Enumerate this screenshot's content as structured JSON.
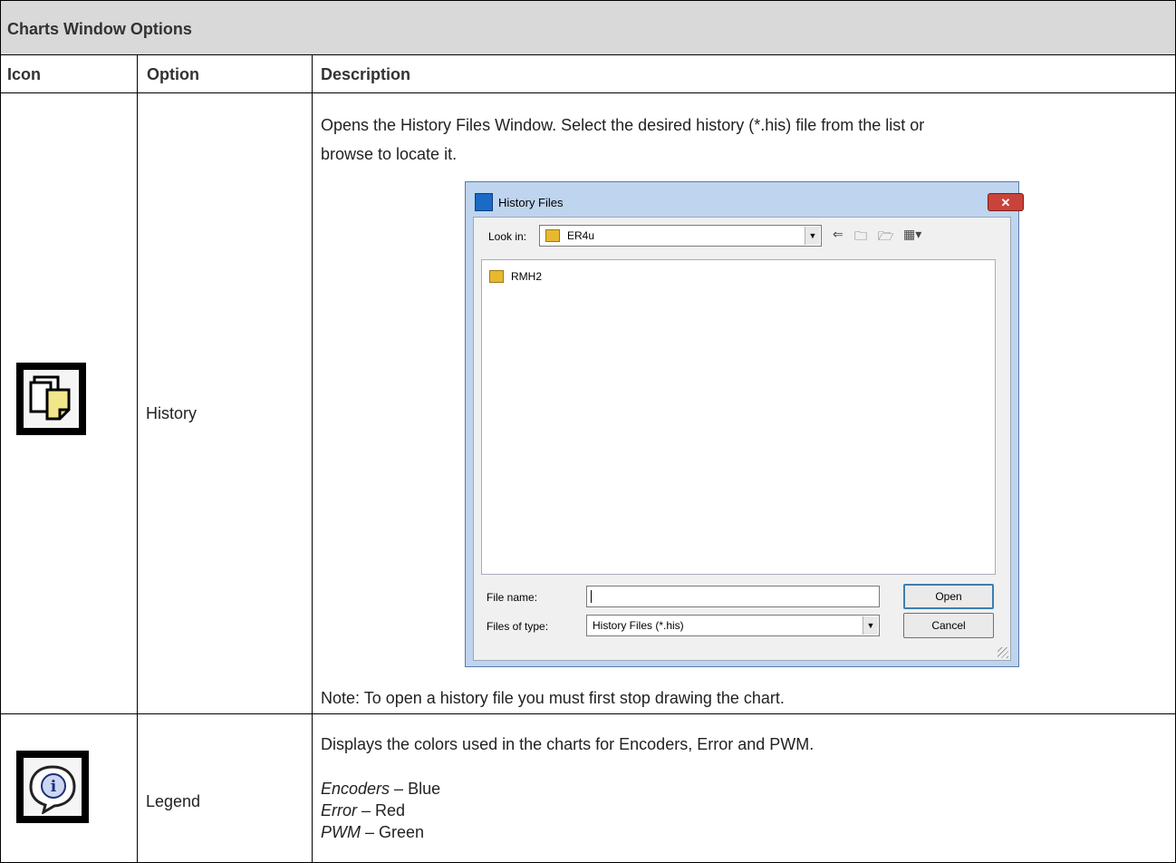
{
  "table": {
    "title": "Charts Window Options",
    "headers": {
      "icon": "Icon",
      "option": "Option",
      "description": "Description"
    },
    "rows": [
      {
        "icon": "history-icon",
        "option": "History",
        "description_line1": "Opens the History Files Window. Select the desired history (*.his) file from the list or",
        "description_line2": "browse to locate it.",
        "note": "Note: To open a history file you must first stop drawing the chart."
      },
      {
        "icon": "legend-info-icon",
        "option": "Legend",
        "description": "Displays the colors used in the charts for Encoders, Error and PWM.",
        "items": [
          {
            "name": "Encoders",
            "color": "Blue"
          },
          {
            "name": "Error",
            "color": "Red"
          },
          {
            "name": "PWM",
            "color": "Green"
          }
        ],
        "separator": " – "
      }
    ]
  },
  "dialog": {
    "title": "History Files",
    "close": "✕",
    "look_in_label": "Look in:",
    "look_in_value": "ER4u",
    "files": [
      {
        "name": "RMH2",
        "icon": "folder-icon"
      }
    ],
    "file_name_label": "File name:",
    "file_name_value": "",
    "files_of_type_label": "Files of type:",
    "files_of_type_value": "History Files (*.his)",
    "open_button": "Open",
    "cancel_button": "Cancel",
    "toolbar_icons": [
      "back-arrow-icon",
      "up-folder-icon",
      "new-folder-icon",
      "view-menu-icon"
    ]
  }
}
